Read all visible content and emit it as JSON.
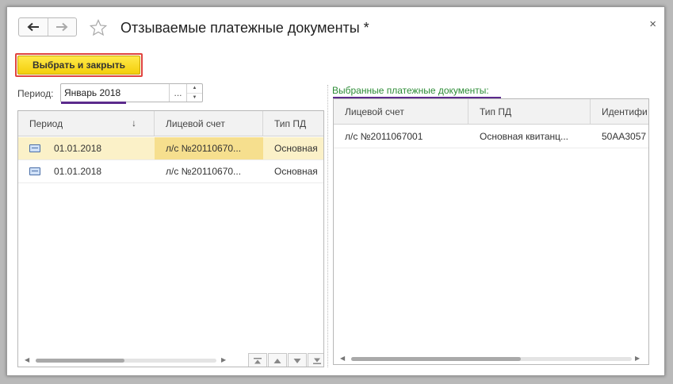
{
  "window": {
    "title": "Отзываемые платежные документы *",
    "close": "×"
  },
  "toolbar": {
    "select_close_label": "Выбрать и закрыть"
  },
  "period": {
    "label": "Период:",
    "value": "Январь 2018",
    "choose": "..."
  },
  "left_table": {
    "sort_indicator": "↓",
    "columns": [
      "Период",
      "Лицевой счет",
      "Тип ПД"
    ],
    "rows": [
      [
        "01.01.2018",
        "л/с №20110670...",
        "Основная"
      ],
      [
        "01.01.2018",
        "л/с №20110670...",
        "Основная"
      ]
    ]
  },
  "right_panel": {
    "label": "Выбранные платежные документы:",
    "columns": [
      "Лицевой счет",
      "Тип ПД",
      "Идентифи"
    ],
    "rows": [
      [
        "л/с №2011067001",
        "Основная квитанц...",
        "50AA3057"
      ]
    ]
  },
  "colors": {
    "accent_button": "#f4d10f",
    "highlight_border": "#e0443e",
    "label_green": "#2c8c36",
    "annotation_underline": "#5b2a8c",
    "selected_row": "#fbf1c8"
  }
}
